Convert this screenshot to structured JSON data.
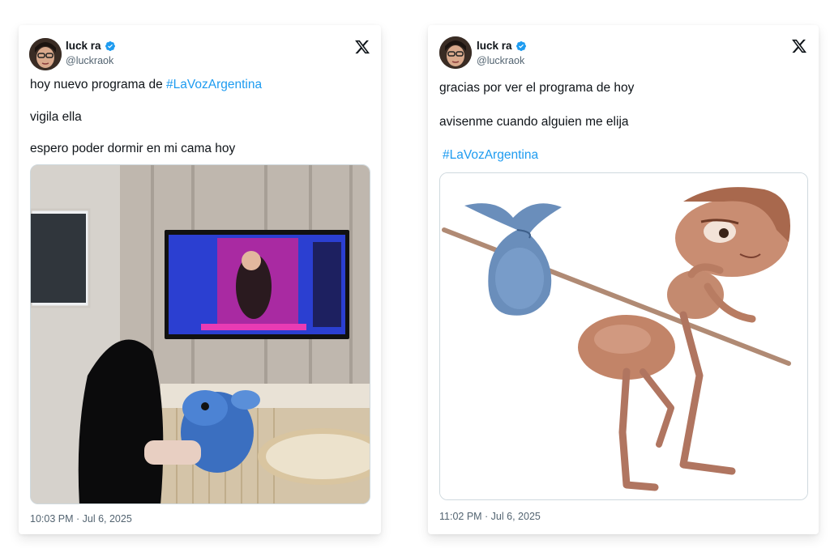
{
  "tweets": [
    {
      "author_name": "luck ra",
      "handle": "@luckraok",
      "lines": [
        {
          "text": "hoy nuevo programa de ",
          "hashtag": "#LaVozArgentina"
        },
        {
          "text": "vigila ella"
        },
        {
          "text": "espero poder dormir en mi cama hoy"
        }
      ],
      "media_alt": "girl-watching-tv-photo",
      "timestamp": "10:03 PM · Jul 6, 2025"
    },
    {
      "author_name": "luck ra",
      "handle": "@luckraok",
      "lines": [
        {
          "text": "gracias por ver el programa de hoy"
        },
        {
          "text": "avisenme cuando alguien me elija"
        },
        {
          "hashtag": "#LaVozArgentina"
        }
      ],
      "media_alt": "ant-with-bindle-gif",
      "timestamp": "11:02 PM · Jul 6, 2025"
    }
  ],
  "icons": {
    "verified": "verified-badge-icon",
    "brand": "x-logo-icon"
  },
  "colors": {
    "hashtag": "#1d9bf0",
    "verified": "#1d9bf0",
    "muted": "#536471",
    "text": "#0f1419"
  }
}
